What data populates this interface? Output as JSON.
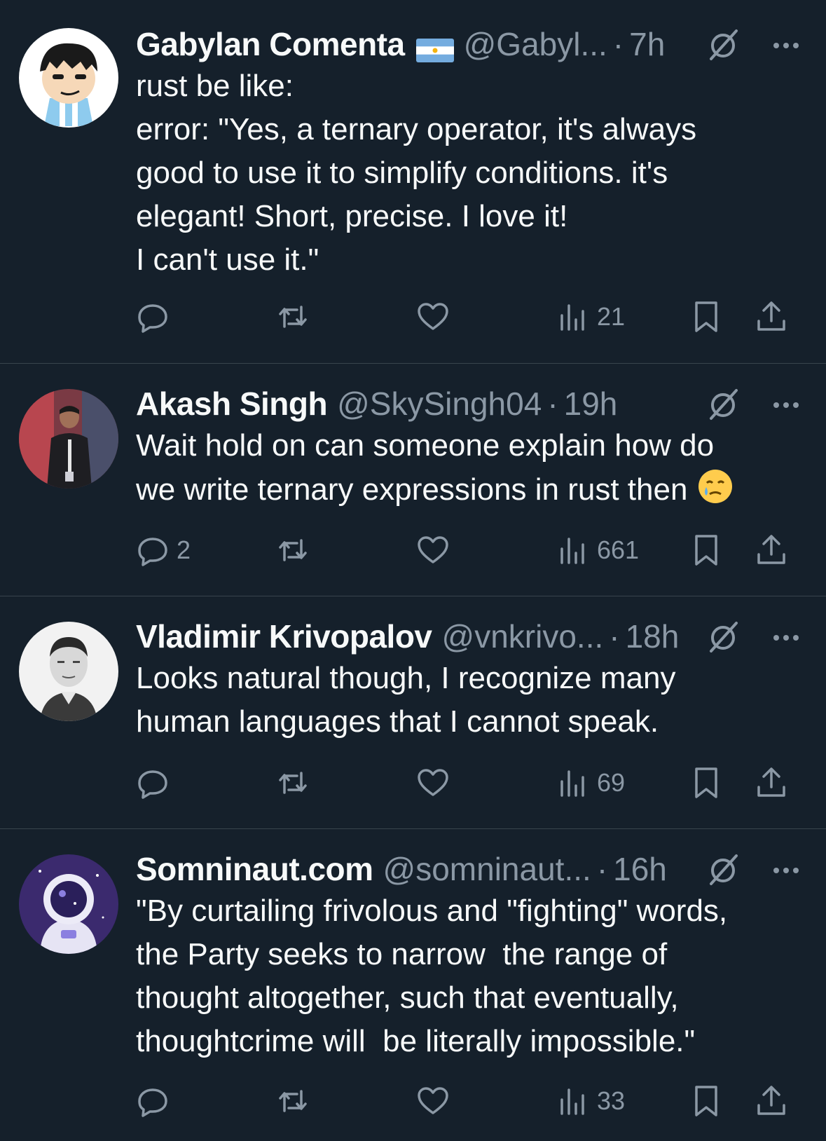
{
  "tweets": [
    {
      "name": "Gabylan Comenta",
      "has_flag": true,
      "handle": "@Gabyl...",
      "time": "7h",
      "lines": [
        "rust be like:",
        "error: \"Yes, a ternary operator, it's always",
        "good to use it to simplify conditions. it's",
        "elegant! Short, precise. I love it!",
        "I can't use it.\""
      ],
      "replies": "",
      "views": "21"
    },
    {
      "name": "Akash Singh",
      "has_flag": false,
      "handle": "@SkySingh04",
      "time": "19h",
      "lines": [
        "Wait hold on can someone explain how do",
        "we write ternary expressions in rust then"
      ],
      "replies": "2",
      "views": "661"
    },
    {
      "name": "Vladimir Krivopalov",
      "has_flag": false,
      "handle": "@vnkrivo...",
      "time": "18h",
      "lines": [
        "Looks natural though, I recognize many",
        "human languages that I cannot speak."
      ],
      "replies": "",
      "views": "69"
    },
    {
      "name": "Somninaut.com",
      "has_flag": false,
      "handle": "@somninaut...",
      "time": "16h",
      "lines": [
        "\"By curtailing frivolous and \"fighting\" words,",
        "the Party seeks to narrow  the range of",
        "thought altogether, such that eventually,",
        "thoughtcrime will  be literally impossible.\""
      ],
      "replies": "",
      "views": "33"
    }
  ],
  "icons": {
    "reply": "reply-icon",
    "retweet": "retweet-icon",
    "like": "heart-icon",
    "views": "views-icon",
    "bookmark": "bookmark-icon",
    "share": "share-icon",
    "grok": "grok-icon",
    "more": "more-icon"
  },
  "colors": {
    "background": "#15202b",
    "text": "#f7f9f9",
    "secondary": "#8b98a5",
    "divider": "#38444d"
  }
}
